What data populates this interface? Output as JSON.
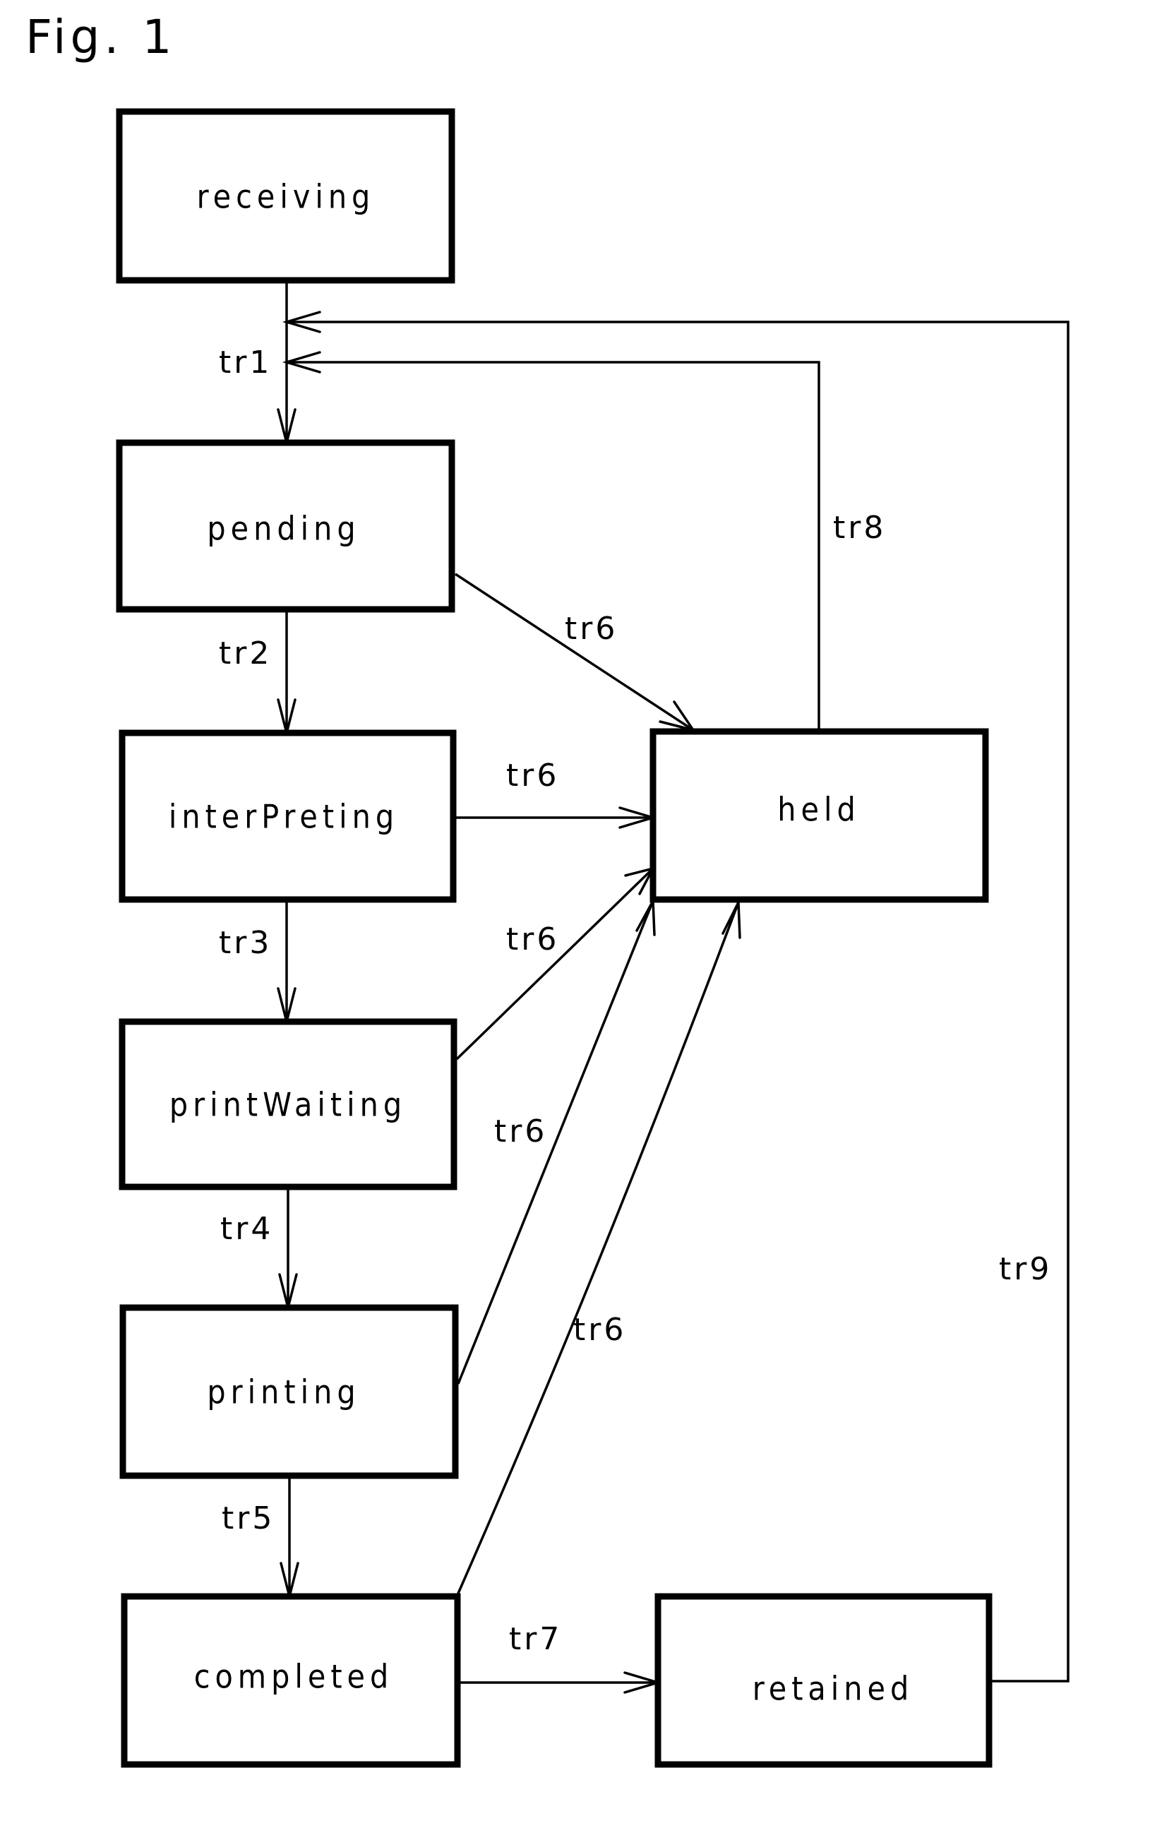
{
  "figure": {
    "title": "Fig. 1"
  },
  "states": [
    {
      "id": "receiving",
      "label": "receiving"
    },
    {
      "id": "pending",
      "label": "pending"
    },
    {
      "id": "interPreting",
      "label": "interPreting"
    },
    {
      "id": "printWaiting",
      "label": "printWaiting"
    },
    {
      "id": "printing",
      "label": "printing"
    },
    {
      "id": "completed",
      "label": "completed"
    },
    {
      "id": "held",
      "label": "held"
    },
    {
      "id": "retained",
      "label": "retained"
    }
  ],
  "transitions": [
    {
      "id": "tr1",
      "label": "tr1",
      "from": "receiving",
      "to": "pending"
    },
    {
      "id": "tr2",
      "label": "tr2",
      "from": "pending",
      "to": "interPreting"
    },
    {
      "id": "tr3",
      "label": "tr3",
      "from": "interPreting",
      "to": "printWaiting"
    },
    {
      "id": "tr4",
      "label": "tr4",
      "from": "printWaiting",
      "to": "printing"
    },
    {
      "id": "tr5",
      "label": "tr5",
      "from": "printing",
      "to": "completed"
    },
    {
      "id": "tr6a",
      "label": "tr6",
      "from": "pending",
      "to": "held"
    },
    {
      "id": "tr6b",
      "label": "tr6",
      "from": "interPreting",
      "to": "held"
    },
    {
      "id": "tr6c",
      "label": "tr6",
      "from": "printWaiting",
      "to": "held"
    },
    {
      "id": "tr6d",
      "label": "tr6",
      "from": "printing",
      "to": "held"
    },
    {
      "id": "tr6e",
      "label": "tr6",
      "from": "completed",
      "to": "held"
    },
    {
      "id": "tr7",
      "label": "tr7",
      "from": "completed",
      "to": "retained"
    },
    {
      "id": "tr8",
      "label": "tr8",
      "from": "held",
      "to": "pending"
    },
    {
      "id": "tr9",
      "label": "tr9",
      "from": "retained",
      "to": "pending"
    }
  ]
}
